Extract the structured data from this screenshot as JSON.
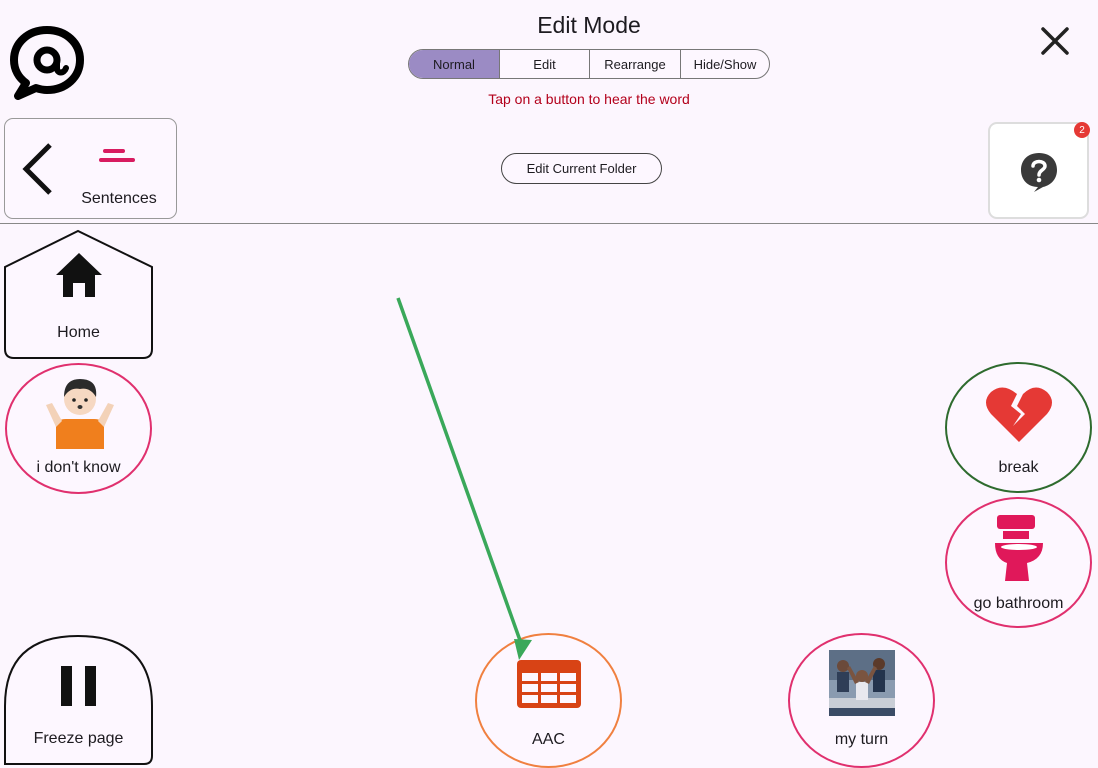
{
  "header": {
    "title": "Edit Mode",
    "modes": [
      "Normal",
      "Edit",
      "Rearrange",
      "Hide/Show"
    ],
    "active_mode": "Normal",
    "hint": "Tap on a button to hear the word"
  },
  "toolbar": {
    "folder_label": "Sentences",
    "edit_folder_label": "Edit Current Folder",
    "help_badge": "2"
  },
  "tiles": {
    "home": "Home",
    "dont_know": "i don't know",
    "break_label": "break",
    "bathroom": "go bathroom",
    "freeze": "Freeze page",
    "aac": "AAC",
    "my_turn": "my turn"
  },
  "colors": {
    "accent_purple": "#9b8bc4",
    "hint_red": "#b3001b",
    "pink_border": "#e0306e",
    "green_border": "#2e6b2e",
    "orange_border": "#f08040",
    "arrow_green": "#3aa85a"
  }
}
